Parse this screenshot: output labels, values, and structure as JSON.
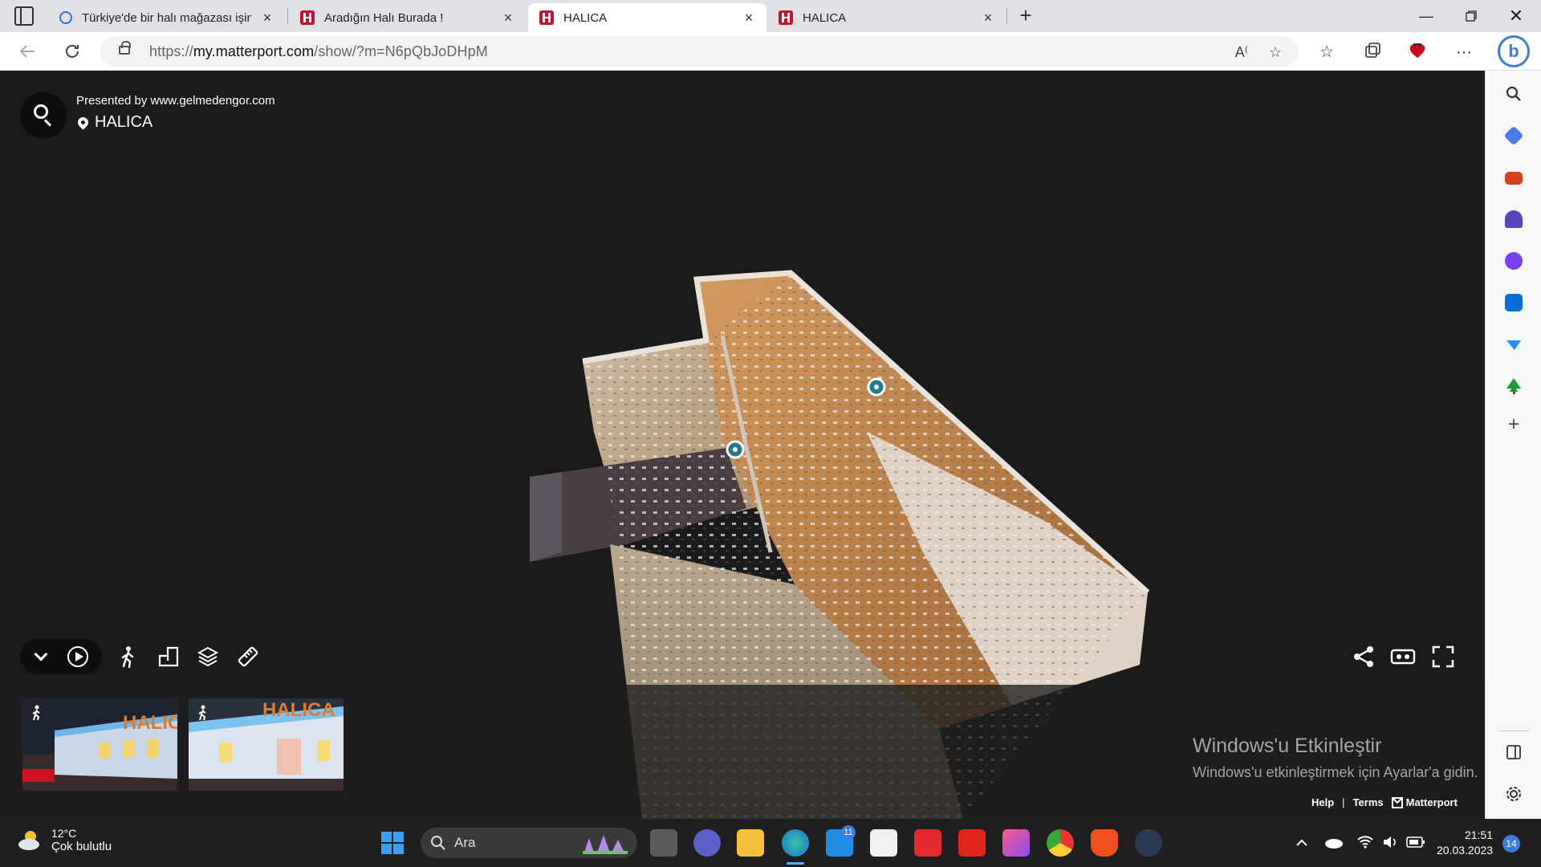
{
  "browser": {
    "tabs": [
      {
        "title": "Türkiye'de bir halı mağazası işini",
        "favicon": "search-icon",
        "active": false
      },
      {
        "title": "Aradığın Halı Burada !",
        "favicon": "halica-logo-icon",
        "active": false
      },
      {
        "title": "HALICA",
        "favicon": "matterport-icon",
        "active": true
      },
      {
        "title": "HALICA",
        "favicon": "matterport-icon",
        "active": false
      }
    ],
    "url_prefix": "https://",
    "url_host": "my.matterport.com",
    "url_path": "/show/?m=N6pQbJoDHpM"
  },
  "viewer": {
    "presented_by": "Presented by www.gelmedengor.com",
    "place_name": "HALICA",
    "thumbnails": [
      {
        "label": "HALICA",
        "icon": "walk-icon"
      },
      {
        "label": "HALICA",
        "icon": "walk-icon"
      }
    ],
    "footer": {
      "help": "Help",
      "separator": "|",
      "terms": "Terms",
      "brand": "Matterport"
    }
  },
  "activation": {
    "title": "Windows'u Etkinleştir",
    "subtitle": "Windows'u etkinleştirmek için Ayarlar'a gidin."
  },
  "taskbar": {
    "weather_temp": "12°C",
    "weather_condition": "Çok bulutlu",
    "search_placeholder": "Ara",
    "mail_badge": "11",
    "time": "21:51",
    "date": "20.03.2023",
    "notification_count": "14"
  },
  "colors": {
    "matterport_red": "#c8102e",
    "edge_blue": "#3b7de0",
    "tag_teal": "#1f7a8c"
  }
}
